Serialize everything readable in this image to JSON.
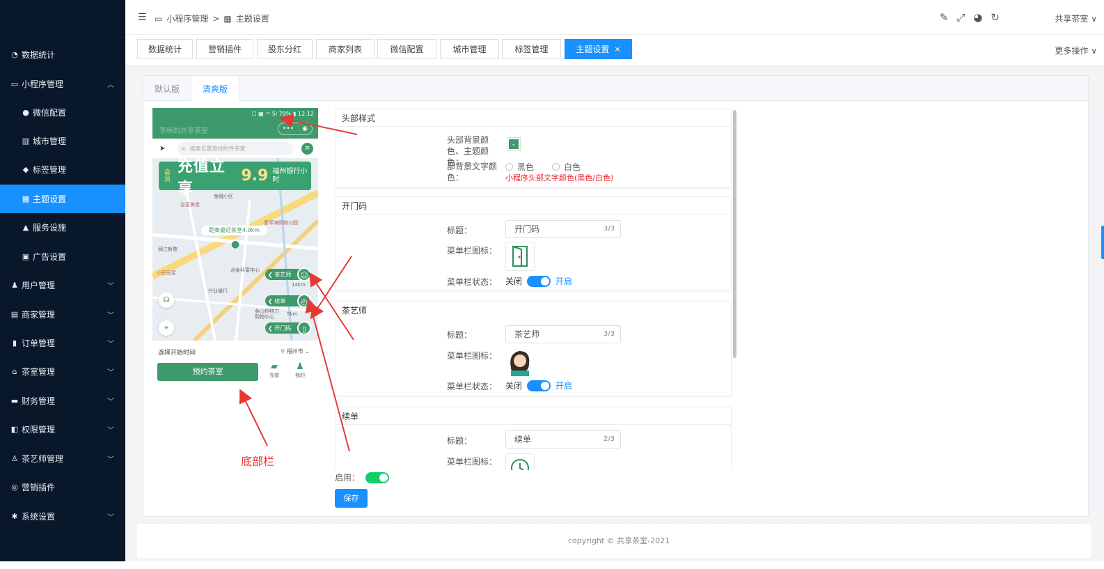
{
  "sidebar": {
    "items": [
      {
        "icon": "dashboard-icon",
        "glyph": "◔",
        "label": "数据统计"
      },
      {
        "icon": "laptop-icon",
        "glyph": "▭",
        "label": "小程序管理"
      },
      {
        "icon": "wechat-icon",
        "glyph": "●",
        "label": "微信配置"
      },
      {
        "icon": "building-icon",
        "glyph": "▥",
        "label": "城市管理"
      },
      {
        "icon": "tags-icon",
        "glyph": "◆",
        "label": "标签管理"
      },
      {
        "icon": "grid-icon",
        "glyph": "▦",
        "label": "主题设置"
      },
      {
        "icon": "flask-icon",
        "glyph": "▲",
        "label": "服务设施"
      },
      {
        "icon": "ad-icon",
        "glyph": "▣",
        "label": "广告设置"
      },
      {
        "icon": "users-icon",
        "glyph": "♟",
        "label": "用户管理"
      },
      {
        "icon": "store-icon",
        "glyph": "▤",
        "label": "商家管理"
      },
      {
        "icon": "order-icon",
        "glyph": "▮",
        "label": "订单管理"
      },
      {
        "icon": "home-icon",
        "glyph": "⌂",
        "label": "茶室管理"
      },
      {
        "icon": "finance-icon",
        "glyph": "▬",
        "label": "财务管理"
      },
      {
        "icon": "permission-icon",
        "glyph": "◧",
        "label": "权限管理"
      },
      {
        "icon": "tea-master-icon",
        "glyph": "♙",
        "label": "茶艺师管理"
      },
      {
        "icon": "marketing-icon",
        "glyph": "◎",
        "label": "营销插件"
      },
      {
        "icon": "settings-icon",
        "glyph": "✱",
        "label": "系统设置"
      }
    ]
  },
  "header": {
    "menu_icon": "☰",
    "breadcrumb": [
      "小程序管理",
      "主题设置"
    ],
    "breadcrumb_sep": ">",
    "user": "共享茶室",
    "user_caret": "∨",
    "tools": [
      "✎",
      "⤢",
      "◕",
      "↻"
    ]
  },
  "tabs": [
    "数据统计",
    "营销插件",
    "股东分红",
    "商家列表",
    "微信配置",
    "城市管理",
    "标签管理",
    "主题设置"
  ],
  "tab_close": "×",
  "more_ops": "更多操作",
  "more_caret": "∨",
  "subtabs": [
    "默认版",
    "清爽版"
  ],
  "phone": {
    "status": "☐ ▦ ◠ 5l 79% ▮ 12:12",
    "nav_title": "李楠的共享茶室",
    "capsule": [
      "•••",
      "◉"
    ],
    "search_placeholder": "搜索位置查找附件茶室",
    "search_icon": "⌕",
    "loc_icon": "➤",
    "menu_icon": "≡",
    "banner": {
      "tag": "会员",
      "main": "充值立享",
      "num": "9.9",
      "side": "福州银行小时"
    },
    "distance": "距离最近茶室4.0km",
    "pills": [
      {
        "icon": "tea-master-icon",
        "label": "❮ 茶艺师",
        "glyph": "☺"
      },
      {
        "icon": "renew-icon",
        "label": "❮ 续单",
        "glyph": "◴"
      },
      {
        "icon": "door-icon",
        "label": "❮ 开门码",
        "glyph": "▯"
      }
    ],
    "map_labels": [
      "金融小区",
      "吉富美卷",
      "爱琴海购物公园",
      "阀江新苑",
      "小田豆浆",
      "点金科富中心",
      "兴业银行",
      "金山桥特力 购物中心",
      "14km",
      "5km"
    ],
    "headset_icon": "☊",
    "target_icon": "⌖",
    "start_time": "选择开始时间",
    "city": "福州市",
    "pin_icon": "⚲",
    "book_button": "预约茶室",
    "bottom_icons": [
      {
        "label": "充值",
        "glyph": "▰"
      },
      {
        "label": "我的",
        "glyph": "♟"
      }
    ]
  },
  "settings": {
    "header_style": {
      "title": "头部样式",
      "bg_color_label": "头部背景颜色、主题颜色：",
      "color": "#3e9a6a",
      "color_caret": "⌄",
      "text_color_label": "部背景文字颜色：",
      "options": [
        "黑色",
        "白色"
      ],
      "hint": "小程序头部文字颜色(黑色/白色)"
    },
    "sections": [
      {
        "title": "开门码",
        "title_label": "标题：",
        "value": "开门码",
        "count": "3/3",
        "icon_label": "菜单栏图标：",
        "icon": "door-icon",
        "status_label": "菜单栏状态：",
        "off": "关闭",
        "on": "开启"
      },
      {
        "title": "茶艺师",
        "title_label": "标题：",
        "value": "茶艺师",
        "count": "3/3",
        "icon_label": "菜单栏图标：",
        "icon": "tea-master-avatar-icon",
        "status_label": "菜单栏状态：",
        "off": "关闭",
        "on": "开启"
      },
      {
        "title": "续单",
        "title_label": "标题：",
        "value": "续单",
        "count": "2/3",
        "icon_label": "菜单栏图标：",
        "icon": "clock-icon"
      }
    ],
    "enable_label": "启用：",
    "save": "保存"
  },
  "annotation": "底部栏",
  "footer": "copyright © 共享茶室-2021",
  "colors": {
    "sidebar": "#08172a",
    "accent": "#1890ff",
    "green": "#3e9a6a",
    "red": "#e53935"
  }
}
